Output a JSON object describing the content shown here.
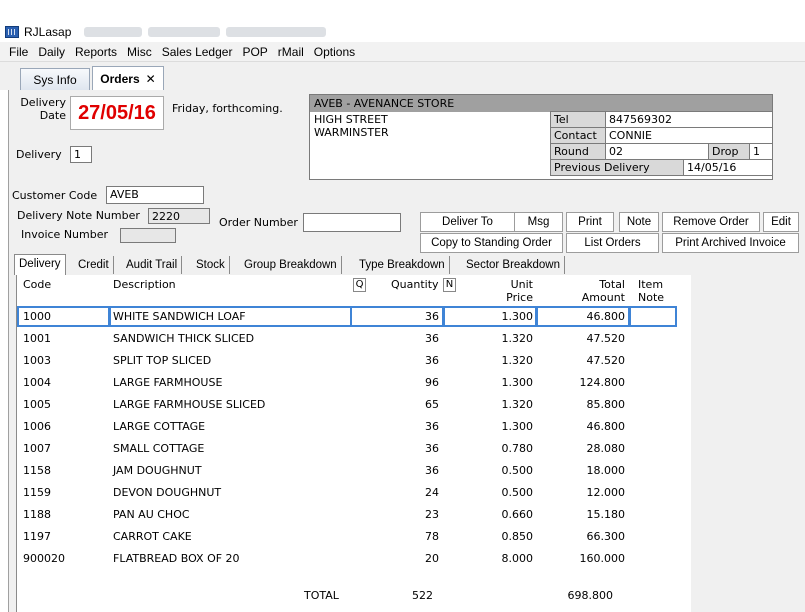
{
  "window": {
    "title": "RJLasap"
  },
  "menu": [
    "File",
    "Daily",
    "Reports",
    "Misc",
    "Sales Ledger",
    "POP",
    "rMail",
    "Options"
  ],
  "tabs": [
    {
      "label": "Sys Info"
    },
    {
      "label": "Orders",
      "close": "✕"
    }
  ],
  "delivery": {
    "date_label_1": "Delivery",
    "date_label_2": "Date",
    "date": "27/05/16",
    "date_note": "Friday, forthcoming.",
    "delivery_label": "Delivery",
    "delivery_no": "1"
  },
  "store": {
    "header": "AVEB - AVENANCE STORE",
    "address": [
      "HIGH STREET",
      "WARMINSTER"
    ],
    "tel_label": "Tel",
    "tel": "847569302",
    "contact_label": "Contact",
    "contact": "CONNIE",
    "round_label": "Round",
    "round": "02",
    "drop_label": "Drop",
    "drop": "1",
    "prev_label": "Previous Delivery",
    "prev": "14/05/16"
  },
  "form": {
    "customer_code_label": "Customer Code",
    "customer_code": "AVEB",
    "delivery_note_label": "Delivery Note Number",
    "delivery_note": "2220",
    "invoice_label": "Invoice Number",
    "invoice": "",
    "order_number_label": "Order Number",
    "order_number": ""
  },
  "buttons": {
    "deliver_to": "Deliver To",
    "msg": "Msg",
    "print": "Print",
    "note": "Note",
    "remove_order": "Remove Order",
    "edit": "Edit",
    "copy_standing": "Copy to Standing Order",
    "list_orders": "List Orders",
    "print_archived": "Print Archived Invoice"
  },
  "subtabs": [
    "Delivery",
    "Credit",
    "Audit Trail",
    "Stock",
    "Group Breakdown",
    "Type Breakdown",
    "Sector Breakdown"
  ],
  "grid": {
    "headers": {
      "code": "Code",
      "description": "Description",
      "q_badge": "Q",
      "quantity": "Quantity",
      "n_badge": "N",
      "unit_1": "Unit",
      "unit_2": "Price",
      "total_1": "Total",
      "total_2": "Amount",
      "note_1": "Item",
      "note_2": "Note"
    },
    "rows": [
      {
        "code": "1000",
        "description": "WHITE SANDWICH LOAF",
        "qty": "36",
        "price": "1.300",
        "amount": "46.800"
      },
      {
        "code": "1001",
        "description": "SANDWICH THICK SLICED",
        "qty": "36",
        "price": "1.320",
        "amount": "47.520"
      },
      {
        "code": "1003",
        "description": "SPLIT TOP SLICED",
        "qty": "36",
        "price": "1.320",
        "amount": "47.520"
      },
      {
        "code": "1004",
        "description": "LARGE FARMHOUSE",
        "qty": "96",
        "price": "1.300",
        "amount": "124.800"
      },
      {
        "code": "1005",
        "description": "LARGE FARMHOUSE SLICED",
        "qty": "65",
        "price": "1.320",
        "amount": "85.800"
      },
      {
        "code": "1006",
        "description": "LARGE COTTAGE",
        "qty": "36",
        "price": "1.300",
        "amount": "46.800"
      },
      {
        "code": "1007",
        "description": "SMALL COTTAGE",
        "qty": "36",
        "price": "0.780",
        "amount": "28.080"
      },
      {
        "code": "1158",
        "description": "JAM DOUGHNUT",
        "qty": "36",
        "price": "0.500",
        "amount": "18.000"
      },
      {
        "code": "1159",
        "description": "DEVON DOUGHNUT",
        "qty": "24",
        "price": "0.500",
        "amount": "12.000"
      },
      {
        "code": "1188",
        "description": "PAN AU CHOC",
        "qty": "23",
        "price": "0.660",
        "amount": "15.180"
      },
      {
        "code": "1197",
        "description": "CARROT CAKE",
        "qty": "78",
        "price": "0.850",
        "amount": "66.300"
      },
      {
        "code": "900020",
        "description": "FLATBREAD BOX OF 20",
        "qty": "20",
        "price": "8.000",
        "amount": "160.000"
      }
    ],
    "total": {
      "label": "TOTAL",
      "qty": "522",
      "amount": "698.800"
    }
  },
  "colors": {
    "date": "#e00000",
    "selection": "#3f84d6"
  }
}
